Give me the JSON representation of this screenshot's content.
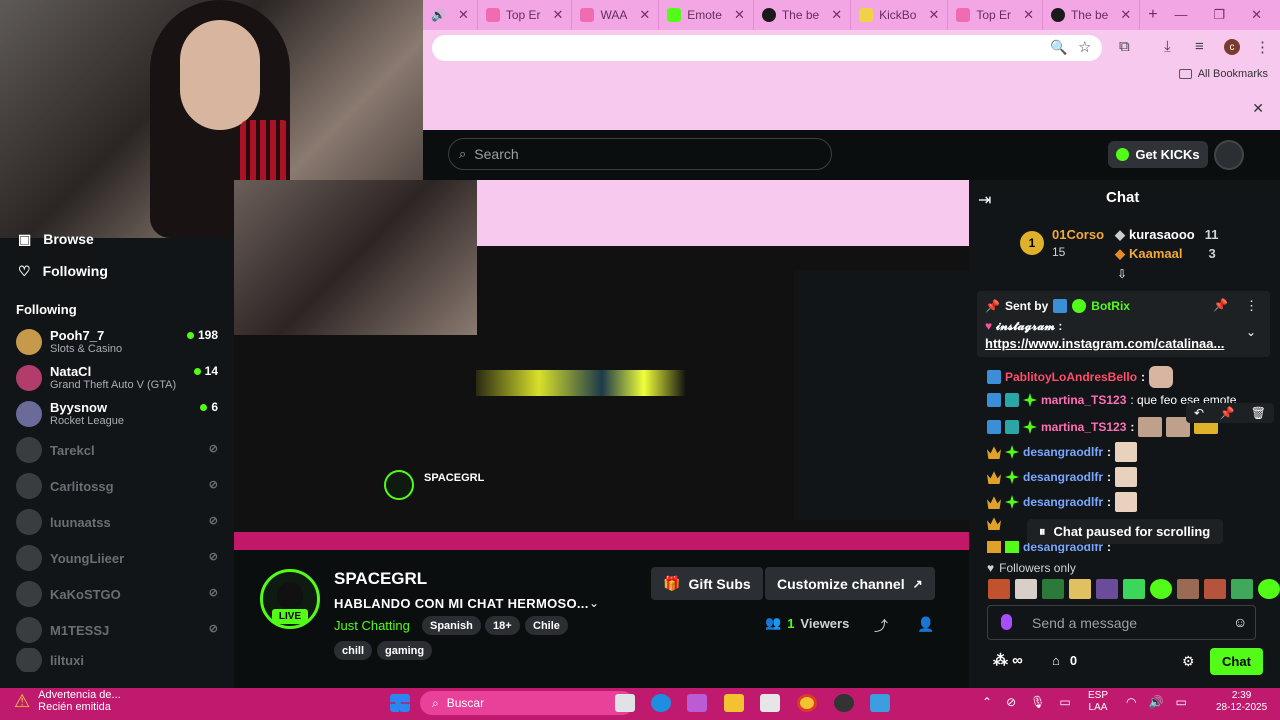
{
  "browser": {
    "tabs": [
      {
        "label": "",
        "color": "#e0447a"
      },
      {
        "label": "Top Er",
        "color": "#f06bb0"
      },
      {
        "label": "WAA",
        "color": "#f06bb0"
      },
      {
        "label": "Emote",
        "color": "#53fc18"
      },
      {
        "label": "The be",
        "color": "#1a1a1a"
      },
      {
        "label": "KickBo",
        "color": "#f0d24a"
      },
      {
        "label": "Top Er",
        "color": "#f06bb0"
      },
      {
        "label": "The be",
        "color": "#1a1a1a"
      }
    ],
    "bookmarks_label": "All Bookmarks",
    "profile_initial": "c"
  },
  "header": {
    "search_placeholder": "Search",
    "get_kicks_label": "Get KICKs"
  },
  "sidebar": {
    "nav": [
      {
        "label": "Browse"
      },
      {
        "label": "Following"
      }
    ],
    "following_heading": "Following",
    "items": [
      {
        "name": "Pooh7_7",
        "game": "Slots & Casino",
        "viewers": "198",
        "live": true,
        "color": "#c79a4b"
      },
      {
        "name": "NataCl",
        "game": "Grand Theft Auto V (GTA)",
        "viewers": "14",
        "live": true,
        "color": "#b23d6d"
      },
      {
        "name": "Byysnow",
        "game": "Rocket League",
        "viewers": "6",
        "live": true,
        "color": "#6b6b9a"
      },
      {
        "name": "Tarekcl",
        "live": false
      },
      {
        "name": "Carlitossg",
        "live": false
      },
      {
        "name": "luunaatss",
        "live": false
      },
      {
        "name": "YoungLiieer",
        "live": false
      },
      {
        "name": "KaKoSTGO",
        "live": false
      },
      {
        "name": "M1TESSJ",
        "live": false
      },
      {
        "name": "liltuxi",
        "live": false
      }
    ]
  },
  "stream": {
    "channel": "SPACEGRL",
    "live_label": "LIVE",
    "title": "HABLANDO CON MI CHAT HERMOSO...",
    "category": "Just Chatting",
    "tags": [
      "Spanish",
      "18+",
      "Chile"
    ],
    "tags2": [
      "chill",
      "gaming"
    ],
    "gift_subs_label": "Gift Subs",
    "customize_label": "Customize channel",
    "viewers_count": "1",
    "viewers_label": "Viewers"
  },
  "chat": {
    "title": "Chat",
    "leaderboard": [
      {
        "rank": "1",
        "name": "01Corso",
        "count": "15"
      },
      {
        "name": "kurasaooo",
        "count": "11"
      },
      {
        "name": "Kaamaal",
        "count": "3"
      }
    ],
    "pinned": {
      "sent_by_label": "Sent by",
      "bot": "BotRix",
      "line1": "𝓲𝓷𝓼𝓽𝓪𝓰𝓻𝓪𝓶 :",
      "link": "https://www.instagram.com/catalinaa..."
    },
    "messages": [
      {
        "user": "PablitoyLoAndresBello",
        "text": ":",
        "color": "#ff4d6a"
      },
      {
        "user": "martina_TS123",
        "text": ": que feo ese emote",
        "color": "#ff6fb5"
      },
      {
        "user": "martina_TS123",
        "text": ":",
        "color": "#ff6fb5"
      },
      {
        "user": "desangraodlfr",
        "text": ":",
        "color": "#7aa7ff"
      },
      {
        "user": "desangraodlfr",
        "text": ":",
        "color": "#7aa7ff"
      },
      {
        "user": "desangraodlfr",
        "text": ":",
        "color": "#7aa7ff"
      },
      {
        "user": "desangraodlfr",
        "text": ":",
        "color": "#7aa7ff"
      }
    ],
    "paused_label": "Chat paused for scrolling",
    "followers_only_label": "Followers only",
    "send_placeholder": "Send a message",
    "send_button": "Chat",
    "points": "0"
  },
  "taskbar": {
    "notification_title": "Advertencia de...",
    "notification_sub": "Recién emitida",
    "search_label": "Buscar",
    "lang1": "ESP",
    "lang2": "LAA",
    "time": "2:39",
    "date": "28-12-2025"
  }
}
